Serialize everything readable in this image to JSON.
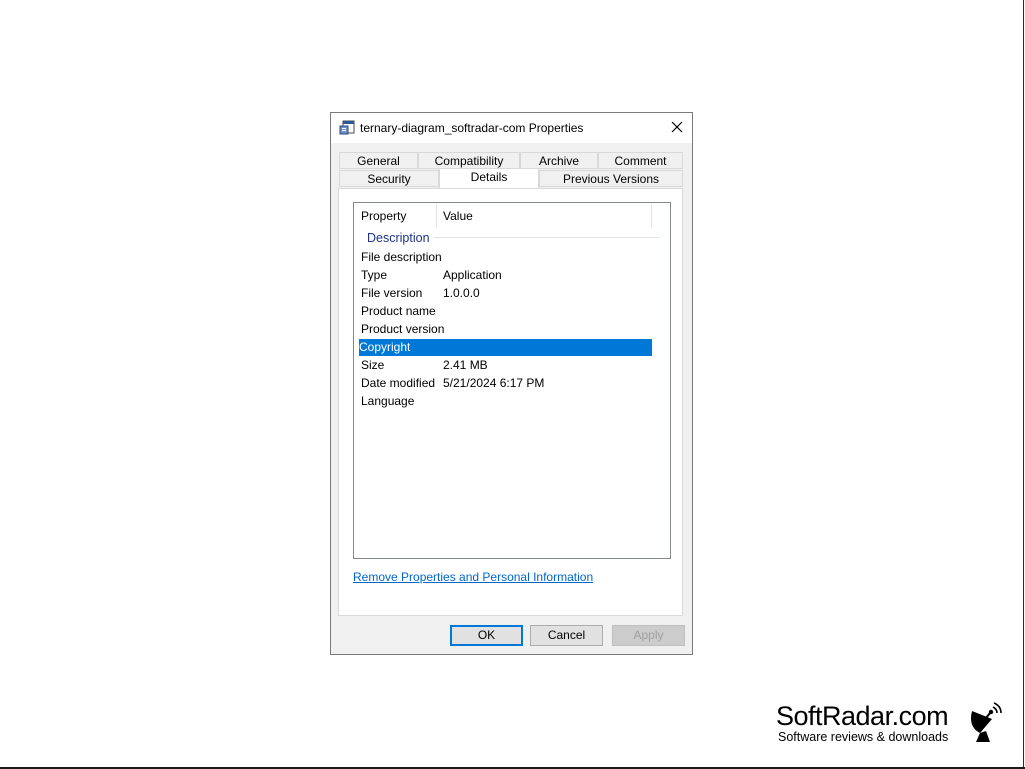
{
  "dialog": {
    "title": "ternary-diagram_softradar-com Properties",
    "tabs_row1": [
      "General",
      "Compatibility",
      "Archive",
      "Comment"
    ],
    "tabs_row2": [
      "Security",
      "Details",
      "Previous Versions"
    ],
    "active_tab": "Details"
  },
  "details": {
    "columns": {
      "property": "Property",
      "value": "Value"
    },
    "group": "Description",
    "rows": [
      {
        "property": "File description",
        "value": ""
      },
      {
        "property": "Type",
        "value": "Application"
      },
      {
        "property": "File version",
        "value": "1.0.0.0"
      },
      {
        "property": "Product name",
        "value": ""
      },
      {
        "property": "Product version",
        "value": ""
      },
      {
        "property": "Copyright",
        "value": ""
      },
      {
        "property": "Size",
        "value": "2.41 MB"
      },
      {
        "property": "Date modified",
        "value": "5/21/2024 6:17 PM"
      },
      {
        "property": "Language",
        "value": ""
      }
    ],
    "selected_row": "Copyright",
    "remove_link": "Remove Properties and Personal Information"
  },
  "buttons": {
    "ok": "OK",
    "cancel": "Cancel",
    "apply": "Apply"
  },
  "watermark": {
    "name": "SoftRadar.com",
    "tagline": "Software reviews & downloads"
  },
  "colors": {
    "accent": "#0078d7",
    "link": "#0066cc",
    "group_header": "#1e3287"
  },
  "icons": {
    "title": "executable-file-icon",
    "close": "close-icon",
    "brand": "radar-dish-icon"
  }
}
